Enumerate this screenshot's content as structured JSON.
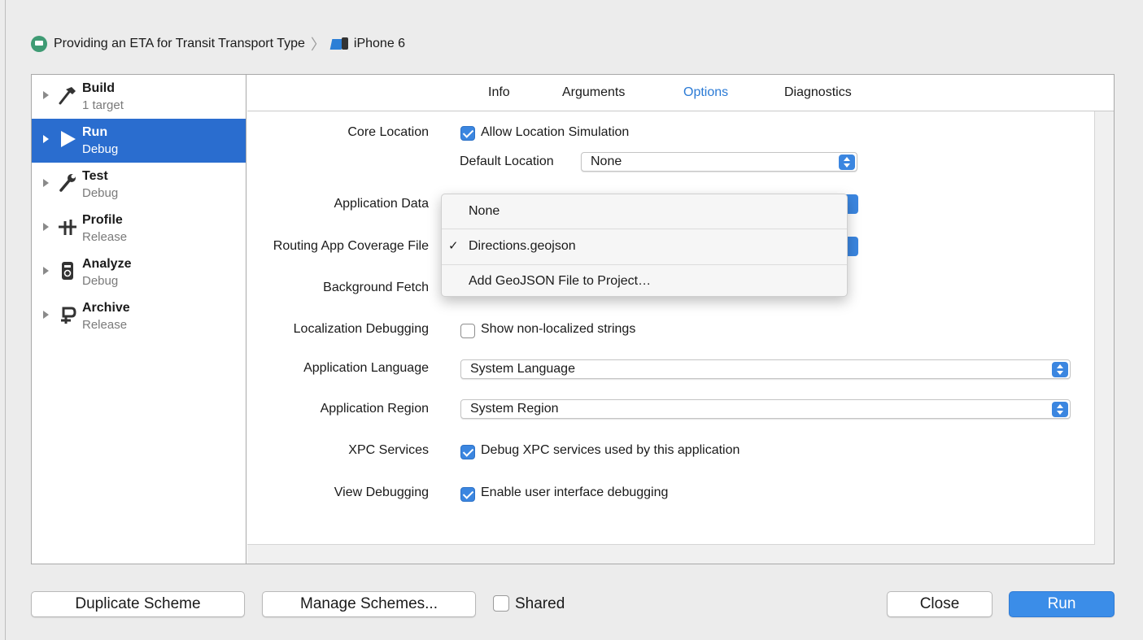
{
  "breadcrumb": {
    "scheme": "Providing an ETA for Transit Transport Type",
    "device": "iPhone 6",
    "scheme_icon": "app-scheme-icon",
    "device_icon": "iphone-device-icon"
  },
  "sidebar": {
    "items": [
      {
        "title": "Build",
        "subtitle": "1 target",
        "icon": "hammer-icon",
        "selected": false
      },
      {
        "title": "Run",
        "subtitle": "Debug",
        "icon": "play-icon",
        "selected": true
      },
      {
        "title": "Test",
        "subtitle": "Debug",
        "icon": "wrench-icon",
        "selected": false
      },
      {
        "title": "Profile",
        "subtitle": "Release",
        "icon": "tuning-fork-icon",
        "selected": false
      },
      {
        "title": "Analyze",
        "subtitle": "Debug",
        "icon": "analyze-icon",
        "selected": false
      },
      {
        "title": "Archive",
        "subtitle": "Release",
        "icon": "vise-icon",
        "selected": false
      }
    ]
  },
  "tabs": {
    "info": "Info",
    "arguments": "Arguments",
    "options": "Options",
    "diagnostics": "Diagnostics",
    "active": "Options"
  },
  "options": {
    "core_location": {
      "label": "Core Location",
      "checkbox_label": "Allow Location Simulation",
      "checked": true
    },
    "default_location": {
      "label": "Default Location",
      "value": "None"
    },
    "application_data": {
      "label": "Application Data"
    },
    "routing_coverage": {
      "label": "Routing App Coverage File"
    },
    "background_fetch": {
      "label": "Background Fetch"
    },
    "localization": {
      "label": "Localization Debugging",
      "checkbox_label": "Show non-localized strings",
      "checked": false
    },
    "app_language": {
      "label": "Application Language",
      "value": "System Language"
    },
    "app_region": {
      "label": "Application Region",
      "value": "System Region"
    },
    "xpc": {
      "label": "XPC Services",
      "checkbox_label": "Debug XPC services used by this application",
      "checked": true
    },
    "view_debugging": {
      "label": "View Debugging",
      "checkbox_label": "Enable user interface debugging",
      "checked": true
    }
  },
  "menu": {
    "items": [
      {
        "label": "None",
        "checked": false
      },
      {
        "label": "Directions.geojson",
        "checked": true,
        "check_mark": "✓"
      },
      {
        "label": "Add GeoJSON File to Project…",
        "checked": false
      }
    ]
  },
  "footer": {
    "duplicate": "Duplicate Scheme",
    "manage": "Manage Schemes...",
    "shared": "Shared",
    "shared_checked": false,
    "close": "Close",
    "run": "Run"
  },
  "colors": {
    "accent": "#2a6dcf",
    "checkbox": "#3b86e0",
    "primary_button": "#3b8de8"
  }
}
